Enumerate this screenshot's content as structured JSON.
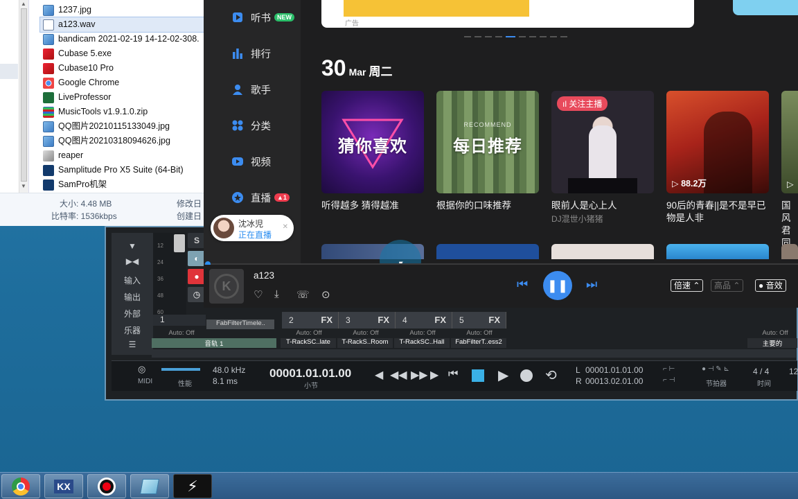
{
  "explorer": {
    "files": [
      {
        "name": "1237.jpg",
        "icon": "image-file-icon",
        "cls": "fi-img"
      },
      {
        "name": "a123.wav",
        "icon": "wav-file-icon",
        "cls": "fi-wav"
      },
      {
        "name": "bandicam 2021-02-19 14-12-02-308.",
        "icon": "image-file-icon",
        "cls": "fi-img"
      },
      {
        "name": "Cubase 5.exe",
        "icon": "cubase-app-icon",
        "cls": "fi-exe"
      },
      {
        "name": "Cubase10 Pro",
        "icon": "cubase-app-icon",
        "cls": "fi-exe"
      },
      {
        "name": "Google Chrome",
        "icon": "chrome-icon",
        "cls": "fi-chrome"
      },
      {
        "name": "LiveProfessor",
        "icon": "liveprofessor-icon",
        "cls": "fi-lp"
      },
      {
        "name": "MusicTools v1.9.1.0.zip",
        "icon": "zip-archive-icon",
        "cls": "fi-zip"
      },
      {
        "name": "QQ图片20210115133049.jpg",
        "icon": "image-file-icon",
        "cls": "fi-img"
      },
      {
        "name": "QQ图片20210318094626.jpg",
        "icon": "image-file-icon",
        "cls": "fi-img"
      },
      {
        "name": "reaper",
        "icon": "reaper-app-icon",
        "cls": "fi-reaper"
      },
      {
        "name": "Samplitude Pro X5 Suite (64-Bit)",
        "icon": "samplitude-app-icon",
        "cls": "fi-samp"
      },
      {
        "name": "SamPro机架",
        "icon": "samplitude-app-icon",
        "cls": "fi-samp"
      }
    ],
    "selected_index": 1,
    "status": {
      "size_label": "大小: 4.48 MB",
      "bitrate_label": "比特率: 1536kbps",
      "modified_label": "修改日",
      "created_label": "创建日"
    }
  },
  "player": {
    "sidebar": [
      {
        "label": "听书",
        "icon": "book-icon",
        "badge": "NEW",
        "badge_type": "new"
      },
      {
        "label": "排行",
        "icon": "chart-bars-icon"
      },
      {
        "label": "歌手",
        "icon": "singer-person-icon"
      },
      {
        "label": "分类",
        "icon": "category-grid-icon"
      },
      {
        "label": "视频",
        "icon": "video-icon"
      },
      {
        "label": "直播",
        "icon": "live-star-icon",
        "badge": "▲1",
        "badge_type": "live"
      }
    ],
    "banner_ad_label": "广告",
    "date": {
      "day": "30",
      "month": "Mar",
      "weekday": "周二"
    },
    "cards": [
      {
        "title": "听得越多 猜得越准",
        "sub": "",
        "overlay": "猜你喜欢",
        "recommend": "",
        "playcount": "",
        "tag": ""
      },
      {
        "title": "根据你的口味推荐",
        "sub": "",
        "overlay": "每日推荐",
        "recommend": "RECOMMEND",
        "playcount": "",
        "tag": ""
      },
      {
        "title": "眼前人是心上人",
        "sub": "DJ混世小猪猪",
        "overlay": "",
        "recommend": "",
        "playcount": "",
        "tag": "关注主播"
      },
      {
        "title": "90后的青春||是不是早已物是人非",
        "sub": "",
        "overlay": "",
        "recommend": "",
        "playcount": "88.2万",
        "tag": ""
      },
      {
        "title": "国风君同",
        "sub": "",
        "overlay": "",
        "recommend": "",
        "playcount": "",
        "tag": ""
      }
    ],
    "live_bubble": {
      "name": "沈冰児",
      "status": "正在直播"
    },
    "now_playing": {
      "song": "a123",
      "speed_label": "倍速",
      "quality_label": "高品",
      "effect_label": "音效"
    },
    "colors": {
      "accent": "#3c8cf0",
      "live_red": "#ef3c4e",
      "new_green": "#2bbf6a"
    }
  },
  "cubase": {
    "left_labels": [
      "输入",
      "输出",
      "外部",
      "乐器"
    ],
    "meter_ticks": [
      "12",
      "24",
      "36",
      "48",
      "60"
    ],
    "solo_label": "S",
    "channel1": "1",
    "insert_slot": "FabFilterTimele..",
    "channels": [
      {
        "num": "2",
        "fx": "FX",
        "auto": "Auto: Off",
        "name": "T-RackSC..late"
      },
      {
        "num": "3",
        "fx": "FX",
        "auto": "Auto: Off",
        "name": "T-RackS..Room"
      },
      {
        "num": "4",
        "fx": "FX",
        "auto": "Auto: Off",
        "name": "T-RackSC..Hall"
      },
      {
        "num": "5",
        "fx": "FX",
        "auto": "Auto: Off",
        "name": "FabFilterT..ess2"
      }
    ],
    "track1": {
      "auto": "Auto: Off",
      "name": "音轨 1"
    },
    "master": {
      "auto": "Auto: Off",
      "name": "主要的"
    },
    "transport": {
      "midi_label": "MIDI",
      "perf_label": "性能",
      "sample_rate": "48.0 kHz",
      "latency": "8.1 ms",
      "position": "00001.01.01.00",
      "position_unit": "小节",
      "locator_l_label": "L",
      "locator_l": "00001.01.01.00",
      "locator_r_label": "R",
      "locator_r": "00013.02.01.00",
      "metronome_label": "节拍器",
      "signature": "4 / 4",
      "time_label": "时间",
      "tempo_partial": "12"
    }
  },
  "taskbar": {
    "apps": [
      {
        "name": "chrome-taskbar-icon"
      },
      {
        "name": "kx-driver-taskbar-icon",
        "text": "KX"
      },
      {
        "name": "record-taskbar-icon"
      },
      {
        "name": "notes-taskbar-icon"
      },
      {
        "name": "cubase-taskbar-icon"
      }
    ]
  }
}
